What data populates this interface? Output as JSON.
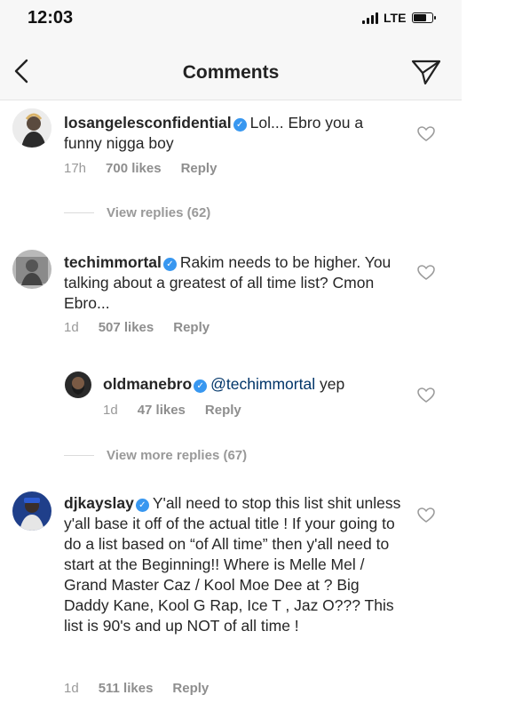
{
  "status": {
    "time": "12:03",
    "network": "LTE"
  },
  "header": {
    "title": "Comments"
  },
  "comments": [
    {
      "username": "losangelesconfidential",
      "text": "Lol... Ebro you a funny nigga boy",
      "time": "17h",
      "likes": "700 likes",
      "reply": "Reply",
      "view_replies": "View replies (62)"
    },
    {
      "username": "techimmortal",
      "text": "Rakim needs to be higher. You talking about a greatest of all time list? Cmon Ebro...",
      "time": "1d",
      "likes": "507 likes",
      "reply": "Reply",
      "view_replies": "View more replies (67)",
      "replies": [
        {
          "username": "oldmanebro",
          "mention": "@techimmortal",
          "text": "yep",
          "time": "1d",
          "likes": "47 likes",
          "reply": "Reply"
        }
      ]
    },
    {
      "username": "djkayslay",
      "text": "Y'all need to stop this list shit unless y'all base it off of the actual title ! If your going to do a list based on “of All time” then y'all need to start at the Beginning!! Where is Melle Mel / Grand Master Caz / Kool Moe Dee at ? Big Daddy Kane, Kool G Rap, Ice T , Jaz O??? This list is 90's and up NOT of all time !",
      "time": "1d",
      "likes": "511 likes",
      "reply": "Reply"
    }
  ]
}
